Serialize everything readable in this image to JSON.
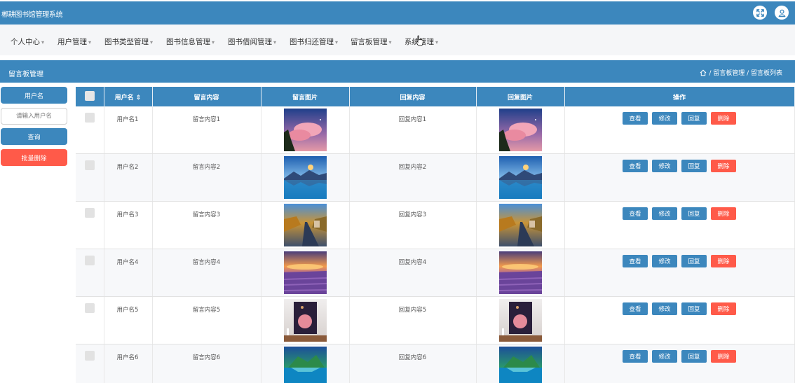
{
  "header": {
    "title": "郴耕图书馆管理系统",
    "icons": [
      "fullscreen-icon",
      "user-icon"
    ]
  },
  "nav": {
    "items": [
      {
        "label": "个人中心"
      },
      {
        "label": "用户管理"
      },
      {
        "label": "图书类型管理"
      },
      {
        "label": "图书信息管理"
      },
      {
        "label": "图书借阅管理"
      },
      {
        "label": "图书归还管理"
      },
      {
        "label": "留言板管理"
      },
      {
        "label": "系统管理"
      }
    ],
    "caret": "▾"
  },
  "section": {
    "title": "留言板管理",
    "breadcrumb": "/ 留言板管理 / 留言板列表"
  },
  "sidebar": {
    "field_label": "用户名",
    "input_placeholder": "请输入用户名",
    "search_label": "查询",
    "batch_delete_label": "批量删除"
  },
  "table": {
    "headers": [
      "用户名 ⇕",
      "留言内容",
      "留言图片",
      "回复内容",
      "回复图片",
      "操作"
    ],
    "rows": [
      {
        "username": "用户名1",
        "message": "留言内容1",
        "reply": "回复内容1",
        "image": "pink-clouds"
      },
      {
        "username": "用户名2",
        "message": "留言内容2",
        "reply": "回复内容2",
        "image": "lake-mountain"
      },
      {
        "username": "用户名3",
        "message": "留言内容3",
        "reply": "回复内容3",
        "image": "road-autumn"
      },
      {
        "username": "用户名4",
        "message": "留言内容4",
        "reply": "回复内容4",
        "image": "lavender-sunset"
      },
      {
        "username": "用户名5",
        "message": "留言内容5",
        "reply": "回复内容5",
        "image": "pink-poster"
      },
      {
        "username": "用户名6",
        "message": "留言内容6",
        "reply": "回复内容6",
        "image": "tropical-island"
      }
    ],
    "actions": {
      "view": "查看",
      "edit": "修改",
      "reply": "回复",
      "delete": "删除"
    }
  },
  "colors": {
    "primary": "#3c87bd",
    "danger": "#ff5a49",
    "nav_bg": "#f5f6f8"
  }
}
